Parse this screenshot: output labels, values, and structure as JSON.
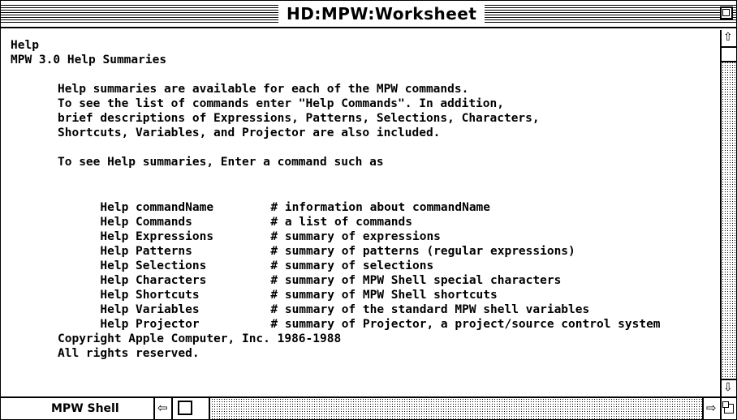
{
  "window": {
    "title": "HD:MPW:Worksheet"
  },
  "content": {
    "heading": "Help",
    "subheading": "MPW 3.0 Help Summaries",
    "intro_lines": [
      "Help summaries are available for each of the MPW commands.",
      "To see the list of commands enter \"Help Commands\". In addition,",
      "brief descriptions of Expressions, Patterns, Selections, Characters,",
      "Shortcuts, Variables, and Projector are also included."
    ],
    "instruction": "To see Help summaries, Enter a command such as",
    "commands": [
      {
        "name": "Help commandName",
        "desc": "# information about commandName"
      },
      {
        "name": "Help Commands",
        "desc": "# a list of commands"
      },
      {
        "name": "Help Expressions",
        "desc": "# summary of expressions"
      },
      {
        "name": "Help Patterns",
        "desc": "# summary of patterns (regular expressions)"
      },
      {
        "name": "Help Selections",
        "desc": "# summary of selections"
      },
      {
        "name": "Help Characters",
        "desc": "# summary of MPW Shell special characters"
      },
      {
        "name": "Help Shortcuts",
        "desc": "# summary of MPW Shell shortcuts"
      },
      {
        "name": "Help Variables",
        "desc": "# summary of the standard MPW shell variables"
      },
      {
        "name": "Help Projector",
        "desc": "# summary of Projector, a project/source control system"
      }
    ],
    "copyright": "Copyright Apple Computer, Inc. 1986-1988",
    "rights": "All rights reserved."
  },
  "status_bar": {
    "label": "MPW Shell"
  },
  "icons": {
    "scroll_up": "up-arrow-icon",
    "scroll_down": "down-arrow-icon",
    "scroll_left": "left-arrow-icon",
    "scroll_right": "right-arrow-icon",
    "zoom": "zoom-box-icon",
    "grow": "grow-box-icon"
  }
}
